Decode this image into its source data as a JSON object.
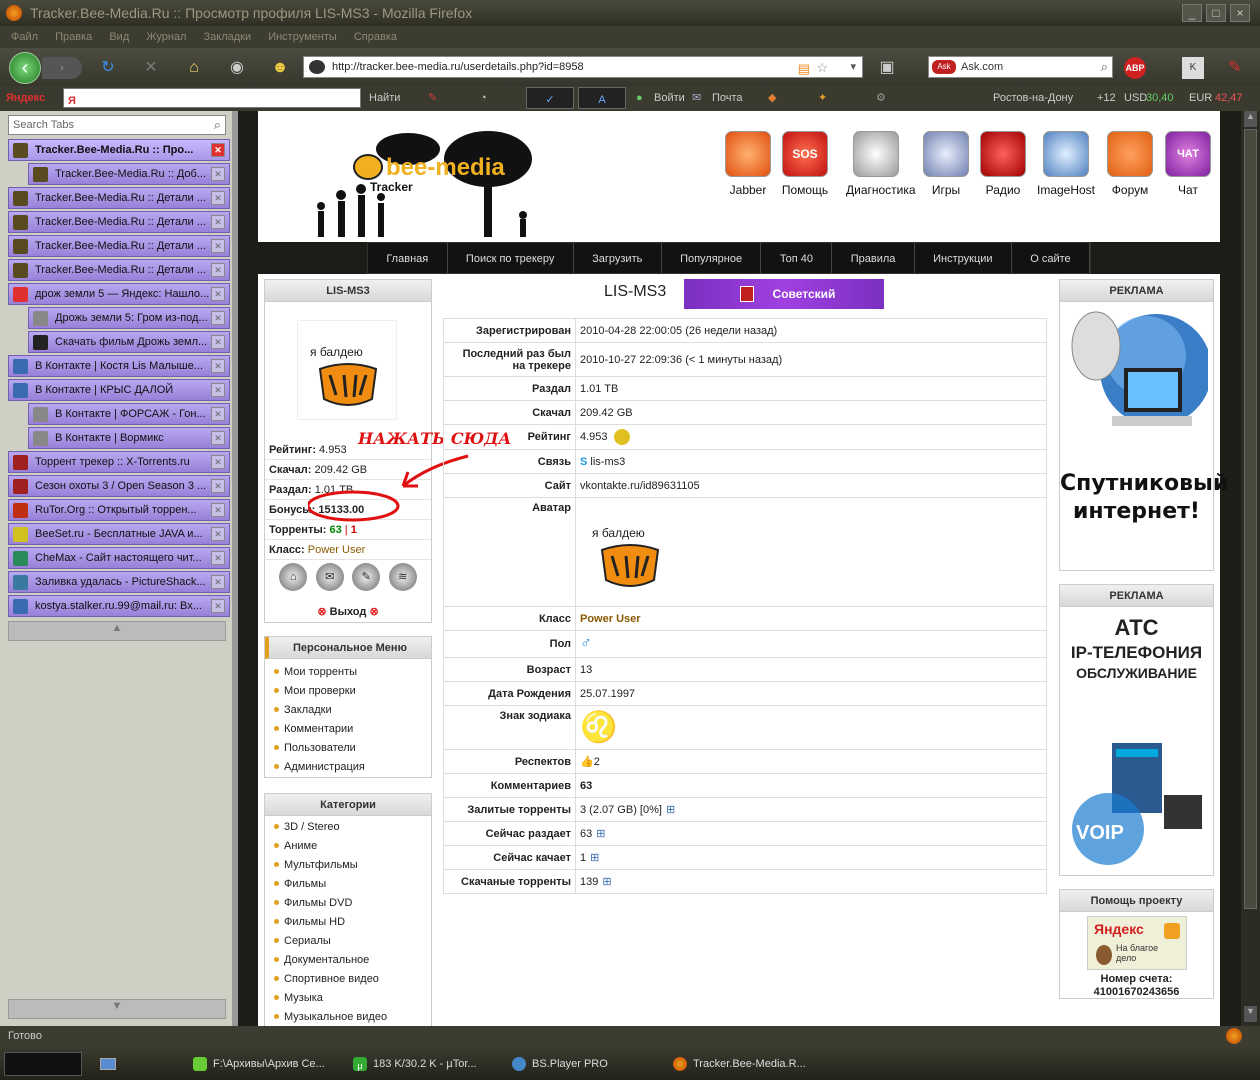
{
  "window": {
    "title": "Tracker.Bee-Media.Ru :: Просмотр профиля LIS-MS3 - Mozilla Firefox"
  },
  "menu": [
    "Файл",
    "Правка",
    "Вид",
    "Журнал",
    "Закладки",
    "Инструменты",
    "Справка"
  ],
  "url": "http://tracker.bee-media.ru/userdetails.php?id=8958",
  "search_engine": "Ask.com",
  "yandex": {
    "label": "Яндекс",
    "find": "Найти",
    "enter": "Войти",
    "mail": "Почта",
    "city": "Ростов-на-Дону",
    "temp": "+12",
    "usd_label": "USD",
    "usd": "30,40",
    "eur_label": "EUR",
    "eur": "42,47"
  },
  "tabs": {
    "search_placeholder": "Search Tabs",
    "items": [
      "Tracker.Bee-Media.Ru :: Про...",
      "Tracker.Bee-Media.Ru :: Доб...",
      "Tracker.Bee-Media.Ru :: Детали ...",
      "Tracker.Bee-Media.Ru :: Детали ...",
      "Tracker.Bee-Media.Ru :: Детали ...",
      "Tracker.Bee-Media.Ru :: Детали ...",
      "дрож земли 5 — Яндекс: Нашло...",
      "Дрожь земли 5: Гром из-под...",
      "Скачать фильм Дрожь земл...",
      "В Контакте | Костя Lis Малыше...",
      "В Контакте | КРЫС ДАЛОЙ",
      "В Контакте | ФОРСАЖ - Гон...",
      "В Контакте | Вормикс",
      "Торрент трекер :: X-Torrents.ru",
      "Сезон охоты 3 / Open Season 3 ...",
      "RuTor.Org :: Открытый торрен...",
      "BeeSet.ru - Бесплатные JAVA и...",
      "CheMax - Сайт настоящего чит...",
      "Заливка удалась - PictureShack...",
      "kostya.stalker.ru.99@mail.ru: Вх..."
    ]
  },
  "site": {
    "logo_text": "bee-media",
    "logo_sub": "Tracker",
    "header_icons": [
      "Jabber",
      "Помощь",
      "Диагностика",
      "Игры",
      "Радио",
      "ImageHost",
      "Форум",
      "Чат"
    ],
    "sos_text": "SOS",
    "chat_text": "ЧАТ",
    "nav": [
      "Главная",
      "Поиск по трекеру",
      "Загрузить",
      "Популярное",
      "Топ 40",
      "Правила",
      "Инструкции",
      "О сайте"
    ]
  },
  "user_box": {
    "username": "LIS-MS3",
    "avatar_text": "я балдею",
    "rating_label": "Рейтинг:",
    "rating": "4.953",
    "down_label": "Скачал:",
    "down": "209.42 GB",
    "up_label": "Раздал:",
    "up": "1.01 TB",
    "bonus_label": "Бонусы:",
    "bonus": "15133.00",
    "torrents_label": "Торренты:",
    "torrents_seed": "63",
    "torrents_sep": "|",
    "torrents_leech": "1",
    "class_label": "Класс:",
    "class": "Power User",
    "logout": "Выход",
    "annotation": "НАЖАТЬ СЮДА"
  },
  "personal_menu": {
    "title": "Персональное Меню",
    "items": [
      "Мои торренты",
      "Мои проверки",
      "Закладки",
      "Комментарии",
      "Пользователи",
      "Администрация"
    ]
  },
  "categories": {
    "title": "Категории",
    "items": [
      "3D / Stereo",
      "Аниме",
      "Мультфильмы",
      "Фильмы",
      "Фильмы DVD",
      "Фильмы HD",
      "Сериалы",
      "Документальное",
      "Спортивное видео",
      "Музыка",
      "Музыкальное видео"
    ]
  },
  "profile": {
    "username": "LIS-MS3",
    "district": "Советский",
    "rows": [
      {
        "k": "Зарегистрирован",
        "v": "2010-04-28 22:00:05 (26 недели назад)"
      },
      {
        "k": "Последний раз был на трекере",
        "v": "2010-10-27 22:09:36 (< 1 минуты назад)"
      },
      {
        "k": "Раздал",
        "v": "1.01 TB"
      },
      {
        "k": "Скачал",
        "v": "209.42 GB"
      },
      {
        "k": "Рейтинг",
        "v": "4.953"
      },
      {
        "k": "Связь",
        "v": "lis-ms3"
      },
      {
        "k": "Сайт",
        "v": "vkontakte.ru/id89631105"
      },
      {
        "k": "Аватар",
        "v": ""
      },
      {
        "k": "Класс",
        "v": "Power User"
      },
      {
        "k": "Пол",
        "v": "♂"
      },
      {
        "k": "Возраст",
        "v": "13"
      },
      {
        "k": "Дата Рождения",
        "v": "25.07.1997"
      },
      {
        "k": "Знак зодиака",
        "v": "♌"
      },
      {
        "k": "Респектов",
        "v": "2"
      },
      {
        "k": "Комментариев",
        "v": "63"
      },
      {
        "k": "Залитые торренты",
        "v": "3 (2.07 GB) [0%]"
      },
      {
        "k": "Сейчас раздает",
        "v": "63"
      },
      {
        "k": "Сейчас качает",
        "v": "1"
      },
      {
        "k": "Скачаные торренты",
        "v": "139"
      }
    ]
  },
  "ads": {
    "ad1_title": "РЕКЛАМА",
    "ad1_text": "Спутниковый интернет!",
    "ad2_title": "РЕКЛАМА",
    "ad2_l1": "АТС",
    "ad2_l2": "IP-телефония",
    "ad2_l3": "обслуживание",
    "ad2_voip": "VOIP",
    "help_title": "Помощь проекту",
    "yandex": "Яндекс",
    "yandex_sub": "На благое дело",
    "account_label": "Номер счета:",
    "account": "41001670243656"
  },
  "status": "Готово",
  "taskbar": [
    "F:\\Архивы\\Архив Се...",
    "183 K/30.2 K - µTor...",
    "BS.Player PRO",
    "Tracker.Bee-Media.R..."
  ]
}
